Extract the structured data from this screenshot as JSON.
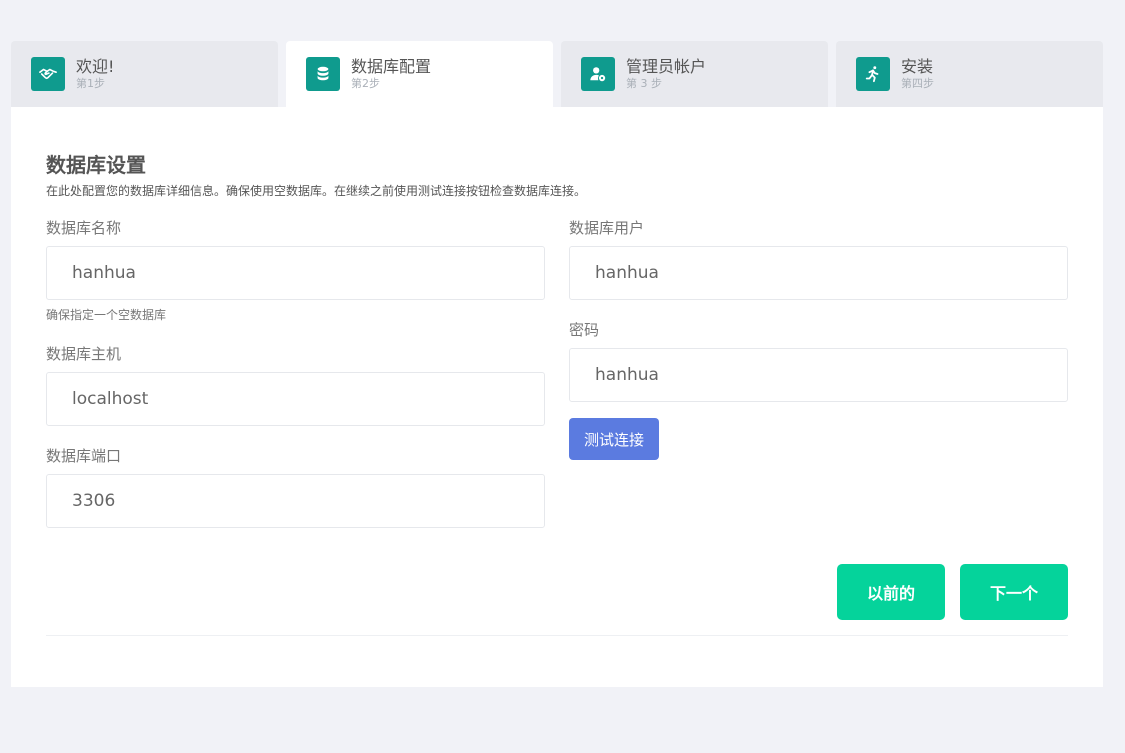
{
  "steps": [
    {
      "title": "欢迎!",
      "sub": "第1步",
      "icon": "handshake-icon",
      "active": false
    },
    {
      "title": "数据库配置",
      "sub": "第2步",
      "icon": "database-icon",
      "active": true
    },
    {
      "title": "管理员帐户",
      "sub": "第 3 步",
      "icon": "user-admin-icon",
      "active": false
    },
    {
      "title": "安装",
      "sub": "第四步",
      "icon": "running-icon",
      "active": false
    }
  ],
  "form": {
    "title": "数据库设置",
    "description": "在此处配置您的数据库详细信息。确保使用空数据库。在继续之前使用测试连接按钮检查数据库连接。",
    "db_name": {
      "label": "数据库名称",
      "value": "hanhua",
      "help": "确保指定一个空数据库"
    },
    "db_host": {
      "label": "数据库主机",
      "value": "localhost"
    },
    "db_port": {
      "label": "数据库端口",
      "value": "3306"
    },
    "db_user": {
      "label": "数据库用户",
      "value": "hanhua"
    },
    "db_pass": {
      "label": "密码",
      "value": "hanhua"
    },
    "test_button": "测试连接"
  },
  "nav": {
    "prev": "以前的",
    "next": "下一个"
  },
  "colors": {
    "step_icon_bg": "#0f9b8e",
    "test_button": "#5b7be0",
    "nav_buttons": "#05d39b"
  }
}
